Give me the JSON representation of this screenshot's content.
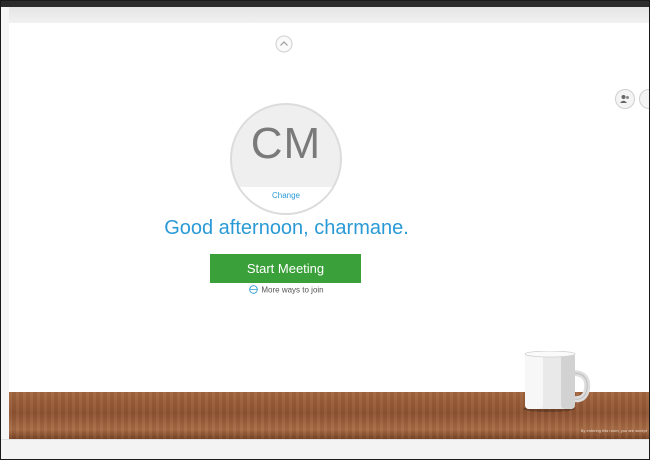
{
  "avatar": {
    "initials": "CM",
    "change_label": "Change"
  },
  "greeting": "Good afternoon, charmane.",
  "start_button": "Start Meeting",
  "more_ways": "More ways to join",
  "disclaimer": "By entering this room, you are accept",
  "icons": {
    "collapse": "chevron-up-icon",
    "contacts": "people-icon",
    "more_ways": "globe-icon"
  },
  "colors": {
    "accent": "#2a9ad6",
    "start_button": "#3aa13a"
  }
}
